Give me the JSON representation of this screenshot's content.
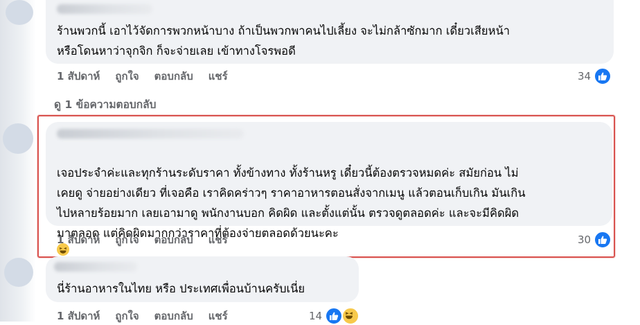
{
  "comments": [
    {
      "text": "ร้านพวกนี้ เอาไว้จัดการพวกหน้าบาง ถ้าเป็นพวกพาคนไปเลี้ยง จะไม่กล้าซักมาก เดี๋ยวเสียหน้า\nหรือโดนหาว่าจุกจิก ก็จะจ่ายเลย เข้าทางโจรพอดี",
      "time": "1 สัปดาห์",
      "like": "ถูกใจ",
      "reply": "ตอบกลับ",
      "share": "แชร์",
      "reactions": "34"
    },
    {
      "text": "เจอประจำค่ะและทุกร้านระดับราคา ทั้งข้างทาง ทั้งร้านหรู เดี๋ยวนี้ต้องตรวจหมดค่ะ สมัยก่อน ไม่\nเคยดู จ่ายอย่างเดียว ที่เจอคือ เราคิดคร่าวๆ ราคาอาหารตอนสั่งจากเมนู แล้วตอนเก็บเกิน มันเกิน\nไปหลายร้อยมาก เลยเอามาดู พนักงานบอก คิดผิด และตั้งแต่นั้น ตรวจดูตลอดค่ะ และจะมีคิดผิด\nมาตลอด แต่คิดผิดมากกว่าราคาที่ต้องจ่ายตลอดด้วยนะคะ",
      "time": "1 สัปดาห์",
      "like": "ถูกใจ",
      "reply": "ตอบกลับ",
      "share": "แชร์",
      "reactions": "30"
    },
    {
      "text": "นี่ร้านอาหารในไทย หรือ ประเทศเพื่อนบ้านครับเนี่ย",
      "time": "1 สัปดาห์",
      "like": "ถูกใจ",
      "reply": "ตอบกลับ",
      "share": "แชร์",
      "reactions": "14"
    }
  ],
  "more_replies": "ดู 1 ข้อความตอบกลับ",
  "colors": {
    "bubble": "#f0f2f5",
    "like_blue": "#1877f2",
    "highlight_red": "#d9534f",
    "secondary_text": "#65676b"
  }
}
